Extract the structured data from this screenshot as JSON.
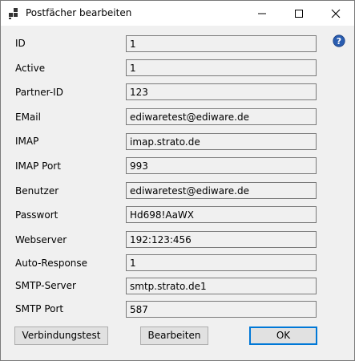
{
  "window": {
    "title": "Postfächer bearbeiten",
    "icon": "app-windows-icon",
    "controls": [
      "minimize-icon",
      "maximize-icon",
      "close-icon"
    ]
  },
  "fields": [
    {
      "label": "ID",
      "value": "1",
      "readonly": true
    },
    {
      "label": "Active",
      "value": "1",
      "readonly": true
    },
    {
      "label": "Partner-ID",
      "value": "123"
    },
    {
      "label": "EMail",
      "value": "ediwaretest@ediware.de"
    },
    {
      "label": "IMAP",
      "value": "imap.strato.de"
    },
    {
      "label": "IMAP Port",
      "value": "993"
    },
    {
      "label": "Benutzer",
      "value": "ediwaretest@ediware.de"
    },
    {
      "label": "Passwort",
      "value": "Hd698!AaWX"
    },
    {
      "label": "Webserver",
      "value": "192:123:456"
    },
    {
      "label": "Auto-Response",
      "value": "1"
    },
    {
      "label": "SMTP-Server",
      "value": "smtp.strato.de1"
    },
    {
      "label": "SMTP Port",
      "value": "587"
    }
  ],
  "help": {
    "icon": "help-icon",
    "color": "#2a5db0"
  },
  "buttons": {
    "test": "Verbindungstest",
    "edit": "Bearbeiten",
    "ok": "OK"
  },
  "colors": {
    "accent": "#0078d7",
    "input_border": "#7a7a7a",
    "dialog_bg": "#f0f0f0"
  }
}
